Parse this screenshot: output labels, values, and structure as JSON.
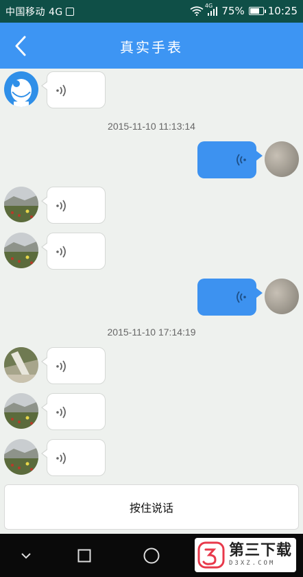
{
  "status_bar": {
    "carrier": "中国移动",
    "network": "4G",
    "signal_type": "4G",
    "battery_percent": "75%",
    "battery_level": 0.75,
    "time": "10:25"
  },
  "app_bar": {
    "title": "真实手表",
    "back_icon": "chevron-left-icon"
  },
  "messages": [
    {
      "direction": "in",
      "type": "voice",
      "avatar": "cartoon-avatar"
    },
    {
      "kind": "timestamp",
      "text": "2015-11-10 11:13:14"
    },
    {
      "direction": "out",
      "type": "voice",
      "avatar": "gray-avatar"
    },
    {
      "direction": "in",
      "type": "voice",
      "avatar": "landscape-avatar"
    },
    {
      "direction": "in",
      "type": "voice",
      "avatar": "landscape-avatar"
    },
    {
      "direction": "out",
      "type": "voice",
      "avatar": "gray-avatar"
    },
    {
      "kind": "timestamp",
      "text": "2015-11-10 17:14:19"
    },
    {
      "direction": "in",
      "type": "voice",
      "avatar": "photo-avatar"
    },
    {
      "direction": "in",
      "type": "voice",
      "avatar": "landscape-avatar"
    },
    {
      "direction": "in",
      "type": "voice",
      "avatar": "landscape-avatar"
    }
  ],
  "input": {
    "hold_to_talk_label": "按住说话"
  },
  "nav_bar": {
    "back_icon": "nav-back-icon",
    "home_icon": "nav-home-icon",
    "recents_icon": "nav-recents-icon"
  },
  "watermark": {
    "title": "第三下载",
    "domain": "D3XZ.COM"
  },
  "colors": {
    "status_bar": "#0f4f47",
    "app_bar": "#3d95f3",
    "outgoing_bubble": "#3d92f0",
    "incoming_bubble": "#ffffff",
    "chat_background": "#eef1ee",
    "nav_bar": "#0a0a0a"
  }
}
